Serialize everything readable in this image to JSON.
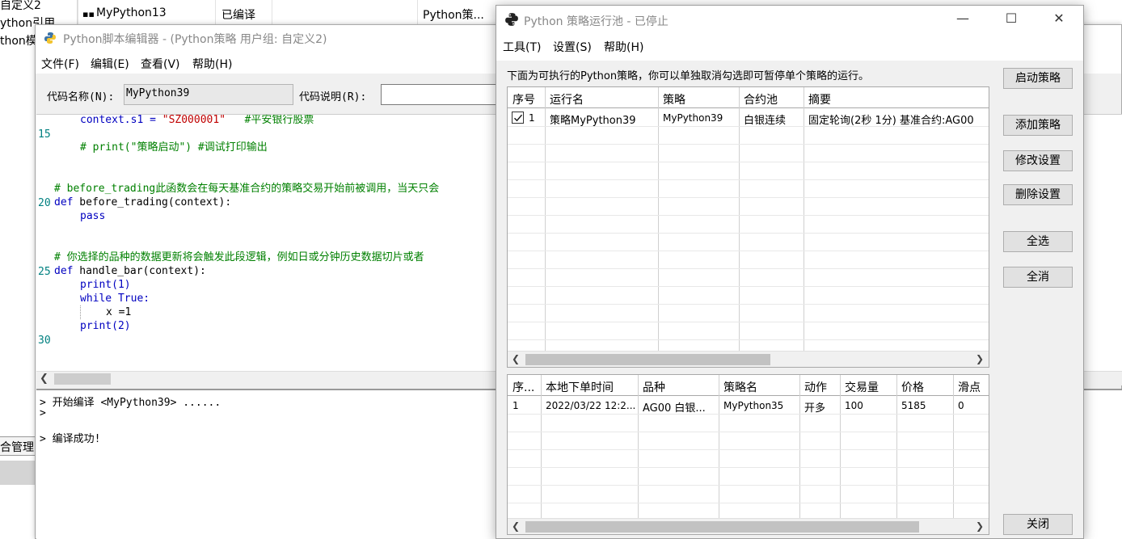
{
  "background": {
    "tree_items": [
      "自定义2",
      "ython引用",
      "thon模"
    ],
    "list_row": {
      "name": "MyPython13",
      "status": "已编译",
      "strategy": "Python策..."
    },
    "tab_label": "合管理"
  },
  "editor": {
    "title": "Python脚本编辑器 - (Python策略 用户组: 自定义2)",
    "menu": [
      "文件(F)",
      "编辑(E)",
      "查看(V)",
      "帮助(H)"
    ],
    "code_name_label": "代码名称(N):",
    "code_name_value": "MyPython39",
    "code_desc_label": "代码说明(R):",
    "code_desc_value": "",
    "line_numbers": [
      "15",
      "20",
      "25",
      "30"
    ],
    "code": {
      "l1_a": "context.s1 = ",
      "l1_b": "\"SZ000001\"",
      "l1_c": "   #平安银行股票",
      "l2": "# print(\"策略启动\") #调试打印输出",
      "l3": "# before_trading此函数会在每天基准合约的策略交易开始前被调用，当天只会",
      "l4_kw": "def",
      "l4": " before_trading(context):",
      "l5": "pass",
      "l6": "# 你选择的品种的数据更新将会触发此段逻辑，例如日或分钟历史数据切片或者",
      "l7_kw": "def",
      "l7": " handle_bar(context):",
      "l8": "print(1)",
      "l9_kw": "while",
      "l9_val": " True:",
      "l10": "x =1",
      "l11": "print(2)"
    },
    "output": [
      "> 开始编译 <MyPython39> ......",
      ">",
      "> 编译成功!"
    ]
  },
  "pool": {
    "title": "Python 策略运行池 - 已停止",
    "menu": [
      "工具(T)",
      "设置(S)",
      "帮助(H)"
    ],
    "description": "下面为可执行的Python策略，你可以单独取消勾选即可暂停单个策略的运行。",
    "strategy_table": {
      "headers": [
        "序号",
        "运行名",
        "策略",
        "合约池",
        "摘要"
      ],
      "rows": [
        {
          "checked": true,
          "index": "1",
          "run_name": "策略MyPython39",
          "strategy": "MyPython39",
          "pool": "白银连续",
          "summary": "固定轮询(2秒 1分) 基准合约:AG00"
        }
      ]
    },
    "order_table": {
      "headers": [
        "序...",
        "本地下单时间",
        "品种",
        "策略名",
        "动作",
        "交易量",
        "价格",
        "滑点"
      ],
      "rows": [
        {
          "index": "1",
          "time": "2022/03/22 12:2...",
          "symbol": "AG00 白银...",
          "strategy": "MyPython35",
          "action": "开多",
          "volume": "100",
          "price": "5185",
          "slippage": "0"
        }
      ]
    },
    "buttons": {
      "start": "启动策略",
      "add": "添加策略",
      "modify": "修改设置",
      "delete": "删除设置",
      "select_all": "全选",
      "deselect_all": "全消",
      "close": "关闭"
    }
  }
}
